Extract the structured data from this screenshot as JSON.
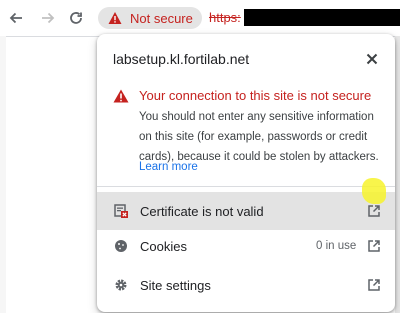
{
  "toolbar": {
    "security_chip_label": "Not secure",
    "url_prefix": "https:"
  },
  "popup": {
    "title": "labsetup.kl.fortilab.net",
    "warning": {
      "heading": "Your connection to this site is not secure",
      "body": "You should not enter any sensitive information on this site (for example, passwords or credit cards), because it could be stolen by attackers.",
      "learn_more": "Learn more"
    },
    "rows": [
      {
        "label": "Certificate is not valid",
        "icon": "certificate-error-icon",
        "meta": ""
      },
      {
        "label": "Cookies",
        "icon": "cookie-icon",
        "meta": "0 in use"
      },
      {
        "label": "Site settings",
        "icon": "gear-icon",
        "meta": ""
      }
    ]
  },
  "colors": {
    "danger": "#c5221f",
    "link": "#1a73e8",
    "highlight": "#f7f32b"
  }
}
